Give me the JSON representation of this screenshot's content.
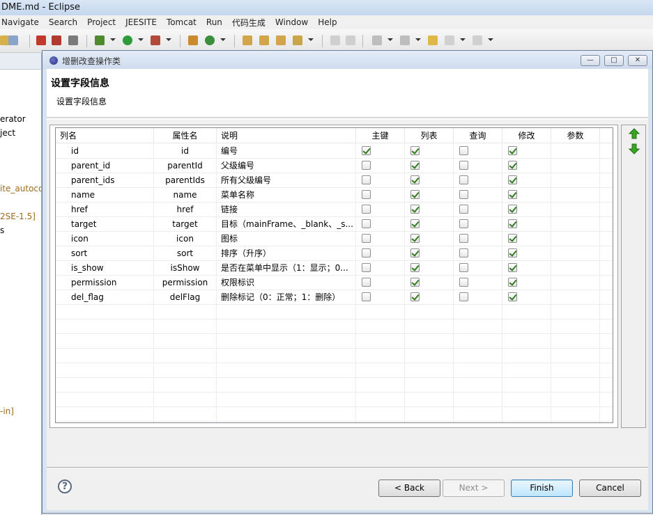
{
  "eclipse": {
    "title": "DME.md - Eclipse",
    "menu": [
      "Navigate",
      "Search",
      "Project",
      "JEESITE",
      "Tomcat",
      "Run",
      "代码生成",
      "Window",
      "Help"
    ],
    "left_panel_texts": [
      "erator",
      "ject",
      "ite_autoco",
      "2SE-1.5]",
      "s",
      "-in]"
    ]
  },
  "dialog": {
    "title": "增删改查操作类",
    "window_buttons": {
      "minimize": "—",
      "maximize": "□",
      "close": "✕"
    },
    "banner_title": "设置字段信息",
    "banner_subtitle": "设置字段信息",
    "columns": [
      "列名",
      "属性名",
      "说明",
      "主键",
      "列表",
      "查询",
      "修改",
      "参数"
    ],
    "rows": [
      {
        "name": "id",
        "prop": "id",
        "desc": "编号",
        "pk": true,
        "list": true,
        "query": false,
        "edit": true
      },
      {
        "name": "parent_id",
        "prop": "parentId",
        "desc": "父级编号",
        "pk": false,
        "list": true,
        "query": false,
        "edit": true
      },
      {
        "name": "parent_ids",
        "prop": "parentIds",
        "desc": "所有父级编号",
        "pk": false,
        "list": true,
        "query": false,
        "edit": true
      },
      {
        "name": "name",
        "prop": "name",
        "desc": "菜单名称",
        "pk": false,
        "list": true,
        "query": false,
        "edit": true
      },
      {
        "name": "href",
        "prop": "href",
        "desc": "链接",
        "pk": false,
        "list": true,
        "query": false,
        "edit": true
      },
      {
        "name": "target",
        "prop": "target",
        "desc": "目标（mainFrame、_blank、_s...",
        "pk": false,
        "list": true,
        "query": false,
        "edit": true
      },
      {
        "name": "icon",
        "prop": "icon",
        "desc": "图标",
        "pk": false,
        "list": true,
        "query": false,
        "edit": true
      },
      {
        "name": "sort",
        "prop": "sort",
        "desc": "排序（升序）",
        "pk": false,
        "list": true,
        "query": false,
        "edit": true
      },
      {
        "name": "is_show",
        "prop": "isShow",
        "desc": "是否在菜单中显示（1：显示；0...",
        "pk": false,
        "list": true,
        "query": false,
        "edit": true
      },
      {
        "name": "permission",
        "prop": "permission",
        "desc": "权限标识",
        "pk": false,
        "list": true,
        "query": false,
        "edit": true
      },
      {
        "name": "del_flag",
        "prop": "delFlag",
        "desc": "删除标记（0：正常；1：删除）",
        "pk": false,
        "list": true,
        "query": false,
        "edit": true
      }
    ],
    "empty_rows": 9,
    "buttons": {
      "back": "< Back",
      "next": "Next >",
      "finish": "Finish",
      "cancel": "Cancel"
    },
    "help": "?",
    "colors": {
      "check": "#2f7d1d",
      "arrow": "#3aa521"
    }
  }
}
